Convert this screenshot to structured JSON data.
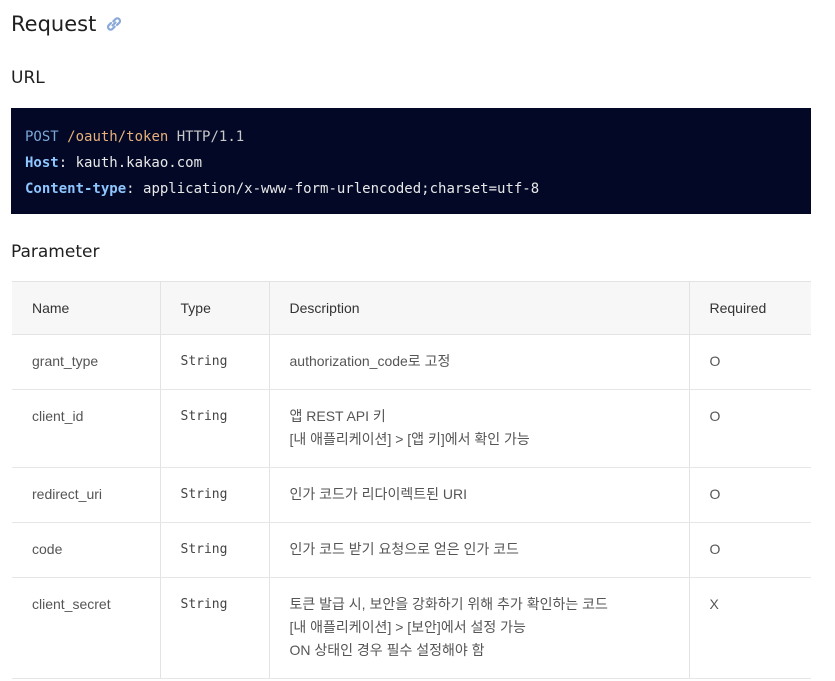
{
  "request": {
    "title": "Request"
  },
  "url_section": {
    "heading": "URL",
    "method": "POST",
    "path": "/oauth/token",
    "protocol": "HTTP/1.1",
    "host_key": "Host",
    "host_value": "kauth.kakao.com",
    "ctype_key": "Content-type",
    "ctype_value": "application/x-www-form-urlencoded;charset=utf-8"
  },
  "parameter": {
    "heading": "Parameter",
    "headers": [
      "Name",
      "Type",
      "Description",
      "Required"
    ],
    "rows": [
      {
        "name": "grant_type",
        "type": "String",
        "desc": [
          "authorization_code로 고정"
        ],
        "required": "O"
      },
      {
        "name": "client_id",
        "type": "String",
        "desc": [
          "앱 REST API 키",
          "[내 애플리케이션] > [앱 키]에서 확인 가능"
        ],
        "required": "O"
      },
      {
        "name": "redirect_uri",
        "type": "String",
        "desc": [
          "인가 코드가 리다이렉트된 URI"
        ],
        "required": "O"
      },
      {
        "name": "code",
        "type": "String",
        "desc": [
          "인가 코드 받기 요청으로 얻은 인가 코드"
        ],
        "required": "O"
      },
      {
        "name": "client_secret",
        "type": "String",
        "desc": [
          "토큰 발급 시, 보안을 강화하기 위해 추가 확인하는 코드",
          "[내 애플리케이션] > [보안]에서 설정 가능",
          "ON 상태인 경우 필수 설정해야 함"
        ],
        "required": "X"
      }
    ]
  },
  "icons": {
    "anchor": "link-icon"
  }
}
